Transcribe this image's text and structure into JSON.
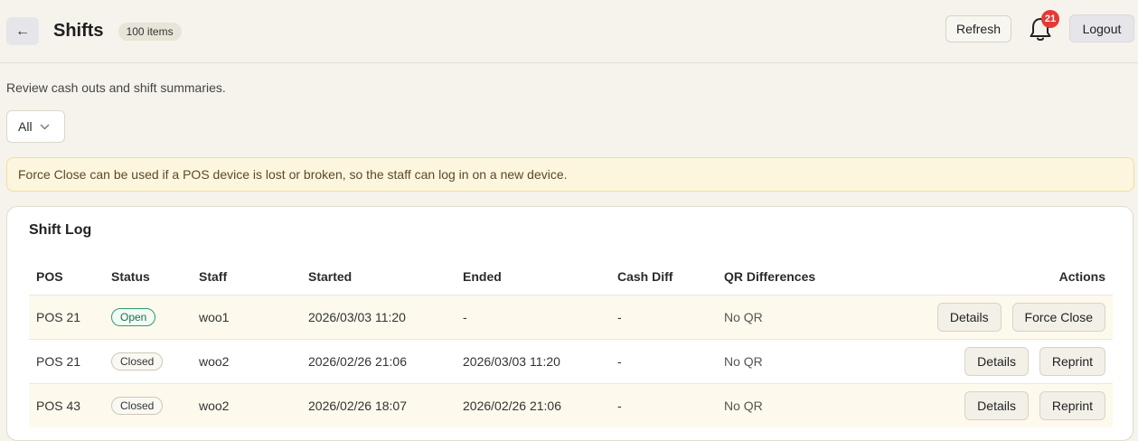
{
  "header": {
    "back_icon": "arrow-left-icon",
    "back_glyph": "←",
    "title": "Shifts",
    "item_count": "100 items",
    "refresh_label": "Refresh",
    "notification_count": "21",
    "logout_label": "Logout"
  },
  "subtitle": "Review cash outs and shift summaries.",
  "filter": {
    "selected": "All"
  },
  "notice": "Force Close can be used if a POS device is lost or broken, so the staff can log in on a new device.",
  "shift_log": {
    "title": "Shift Log",
    "columns": [
      "POS",
      "Status",
      "Staff",
      "Started",
      "Ended",
      "Cash Diff",
      "QR Differences",
      "Actions"
    ],
    "rows": [
      {
        "pos": "POS 21",
        "status": "Open",
        "staff": "woo1",
        "started": "2026/03/03 11:20",
        "ended": "-",
        "cash_diff": "-",
        "qr": "No QR",
        "action1": "Details",
        "action2": "Force Close"
      },
      {
        "pos": "POS 21",
        "status": "Closed",
        "staff": "woo2",
        "started": "2026/02/26 21:06",
        "ended": "2026/03/03 11:20",
        "cash_diff": "-",
        "qr": "No QR",
        "action1": "Details",
        "action2": "Reprint"
      },
      {
        "pos": "POS 43",
        "status": "Closed",
        "staff": "woo2",
        "started": "2026/02/26 18:07",
        "ended": "2026/02/26 21:06",
        "cash_diff": "-",
        "qr": "No QR",
        "action1": "Details",
        "action2": "Reprint"
      }
    ]
  },
  "colors": {
    "background": "#f6f3ec",
    "notification_badge": "#e53935",
    "open_status": "#2e9c6a",
    "notice_bg": "#fdf6de"
  }
}
